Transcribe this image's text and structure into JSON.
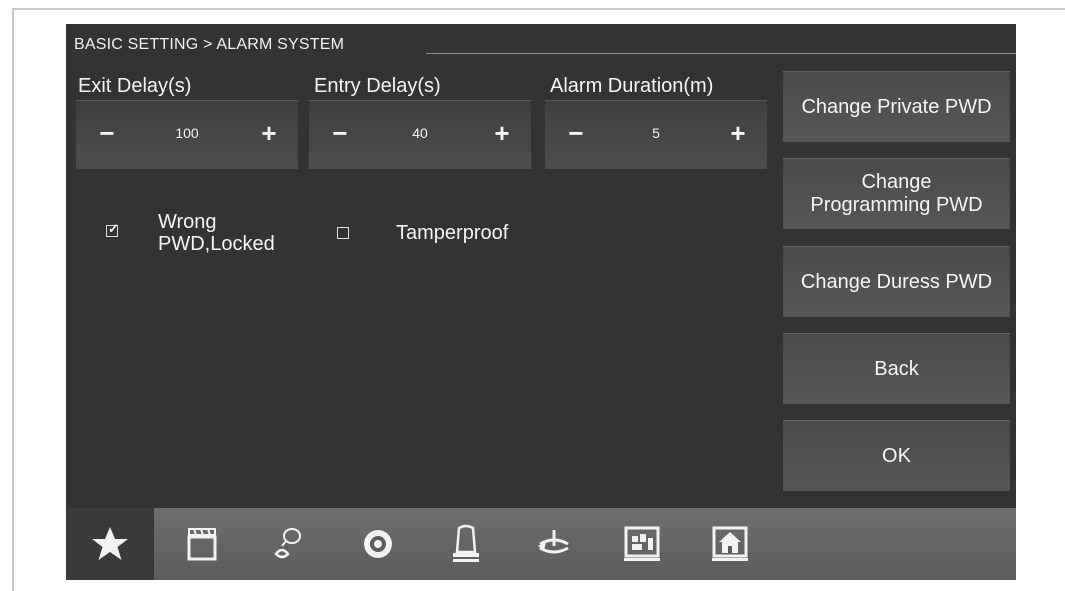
{
  "breadcrumb": "BASIC SETTING > ALARM SYSTEM",
  "fields": [
    {
      "label": "Exit Delay(s)",
      "value": "100",
      "minus": "−",
      "plus": "+"
    },
    {
      "label": "Entry Delay(s)",
      "value": "40",
      "minus": "−",
      "plus": "+"
    },
    {
      "label": "Alarm Duration(m)",
      "value": "5",
      "minus": "−",
      "plus": "+"
    }
  ],
  "options": [
    {
      "label_line1": "Wrong",
      "label_line2": "PWD,Locked",
      "checked": true
    },
    {
      "label": "Tamperproof",
      "checked": false
    }
  ],
  "buttons": {
    "change_private": "Change Private PWD",
    "change_programming_line1": "Change",
    "change_programming_line2": "Programming PWD",
    "change_duress": "Change Duress PWD",
    "back": "Back",
    "ok": "OK"
  },
  "nav_icons": [
    "star-icon",
    "clapperboard-icon",
    "speech-bubble-icon",
    "camera-lens-icon",
    "alarm-siren-icon",
    "rotate-arrow-icon",
    "building-icon",
    "home-icon"
  ],
  "colors": {
    "screen_bg": "#333333",
    "nav_bar": "#5c5c5c",
    "text": "#f5f5f5"
  }
}
